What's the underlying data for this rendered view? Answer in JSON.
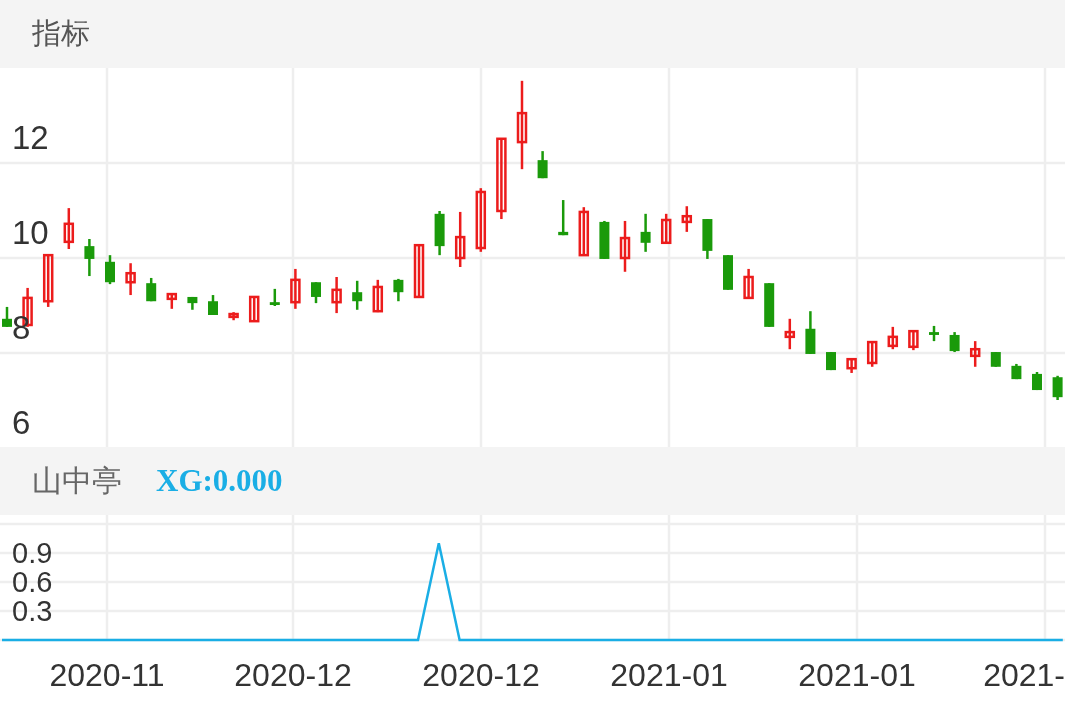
{
  "header": {
    "title": "指标"
  },
  "price_chart": {
    "chart_data": {
      "type": "candlestick",
      "ylim": [
        6,
        14
      ],
      "yticks": [
        {
          "value": 12,
          "label": "12"
        },
        {
          "value": 10,
          "label": "10"
        },
        {
          "value": 8,
          "label": "8"
        },
        {
          "value": 6,
          "label": "6"
        }
      ],
      "grid": true,
      "ohlc": [
        [
          8.72,
          8.97,
          8.55,
          8.55
        ],
        [
          8.59,
          9.37,
          8.55,
          9.16
        ],
        [
          9.09,
          10.06,
          8.97,
          10.06
        ],
        [
          10.34,
          11.05,
          10.19,
          10.72
        ],
        [
          10.25,
          10.4,
          9.62,
          9.98
        ],
        [
          9.92,
          10.06,
          9.45,
          9.49
        ],
        [
          9.49,
          9.89,
          9.22,
          9.68
        ],
        [
          9.47,
          9.58,
          9.09,
          9.09
        ],
        [
          9.14,
          9.24,
          8.93,
          9.24
        ],
        [
          9.18,
          9.18,
          8.91,
          9.05
        ],
        [
          9.09,
          9.22,
          8.8,
          8.8
        ],
        [
          8.76,
          8.86,
          8.69,
          8.82
        ],
        [
          8.67,
          9.2,
          8.67,
          9.18
        ],
        [
          9.07,
          9.35,
          8.99,
          9.01
        ],
        [
          9.07,
          9.77,
          8.93,
          9.54
        ],
        [
          9.49,
          9.49,
          9.05,
          9.18
        ],
        [
          9.07,
          9.6,
          8.84,
          9.33
        ],
        [
          9.28,
          9.52,
          8.91,
          9.09
        ],
        [
          8.88,
          9.54,
          8.86,
          9.39
        ],
        [
          9.54,
          9.56,
          9.09,
          9.28
        ],
        [
          9.18,
          10.27,
          9.18,
          10.27
        ],
        [
          10.93,
          10.99,
          10.06,
          10.25
        ],
        [
          10.0,
          10.97,
          9.81,
          10.44
        ],
        [
          10.21,
          11.47,
          10.13,
          11.39
        ],
        [
          10.99,
          12.51,
          10.82,
          12.51
        ],
        [
          12.44,
          13.73,
          11.87,
          13.05
        ],
        [
          12.06,
          12.25,
          11.68,
          11.68
        ],
        [
          10.55,
          11.22,
          10.48,
          10.48
        ],
        [
          10.06,
          11.07,
          10.06,
          10.97
        ],
        [
          10.76,
          10.78,
          9.98,
          9.98
        ],
        [
          10.0,
          10.78,
          9.71,
          10.42
        ],
        [
          10.55,
          10.93,
          10.13,
          10.32
        ],
        [
          10.32,
          10.93,
          10.32,
          10.8
        ],
        [
          10.76,
          11.09,
          10.55,
          10.88
        ],
        [
          10.82,
          10.82,
          9.98,
          10.15
        ],
        [
          10.06,
          10.06,
          9.33,
          9.33
        ],
        [
          9.16,
          9.77,
          9.16,
          9.6
        ],
        [
          9.47,
          9.47,
          8.55,
          8.55
        ],
        [
          8.34,
          8.72,
          8.08,
          8.44
        ],
        [
          8.51,
          8.88,
          7.98,
          7.98
        ],
        [
          8.02,
          8.02,
          7.64,
          7.64
        ],
        [
          7.68,
          7.87,
          7.58,
          7.87
        ],
        [
          7.79,
          8.23,
          7.71,
          8.23
        ],
        [
          8.15,
          8.55,
          8.08,
          8.34
        ],
        [
          8.13,
          8.46,
          8.06,
          8.46
        ],
        [
          8.44,
          8.57,
          8.25,
          8.38
        ],
        [
          8.38,
          8.44,
          8.02,
          8.04
        ],
        [
          7.94,
          8.25,
          7.71,
          8.08
        ],
        [
          8.02,
          8.02,
          7.71,
          7.71
        ],
        [
          7.73,
          7.77,
          7.45,
          7.45
        ],
        [
          7.56,
          7.6,
          7.22,
          7.22
        ],
        [
          7.49,
          7.52,
          7.01,
          7.07
        ]
      ]
    }
  },
  "indicator_header": {
    "name": "山中亭",
    "value_label": "XG:0.000"
  },
  "indicator_chart": {
    "chart_data": {
      "type": "line",
      "grid": true,
      "ylim": [
        0,
        1.2
      ],
      "yticks": [
        {
          "value": 0.9,
          "label": "0.9"
        },
        {
          "value": 0.6,
          "label": "0.6"
        },
        {
          "value": 0.3,
          "label": "0.3"
        }
      ],
      "series": [
        {
          "color": "#1aaee5",
          "values": [
            0,
            0,
            0,
            0,
            0,
            0,
            0,
            0,
            0,
            0,
            0,
            0,
            0,
            0,
            0,
            0,
            0,
            0,
            0,
            0,
            0,
            1,
            0,
            0,
            0,
            0,
            0,
            0,
            0,
            0,
            0,
            0,
            0,
            0,
            0,
            0,
            0,
            0,
            0,
            0,
            0,
            0,
            0,
            0,
            0,
            0,
            0,
            0,
            0,
            0,
            0,
            0
          ]
        }
      ]
    }
  },
  "x_axis": {
    "labels": [
      "2020-11",
      "2020-12",
      "2020-12",
      "2021-01",
      "2021-01",
      "2021-"
    ]
  }
}
